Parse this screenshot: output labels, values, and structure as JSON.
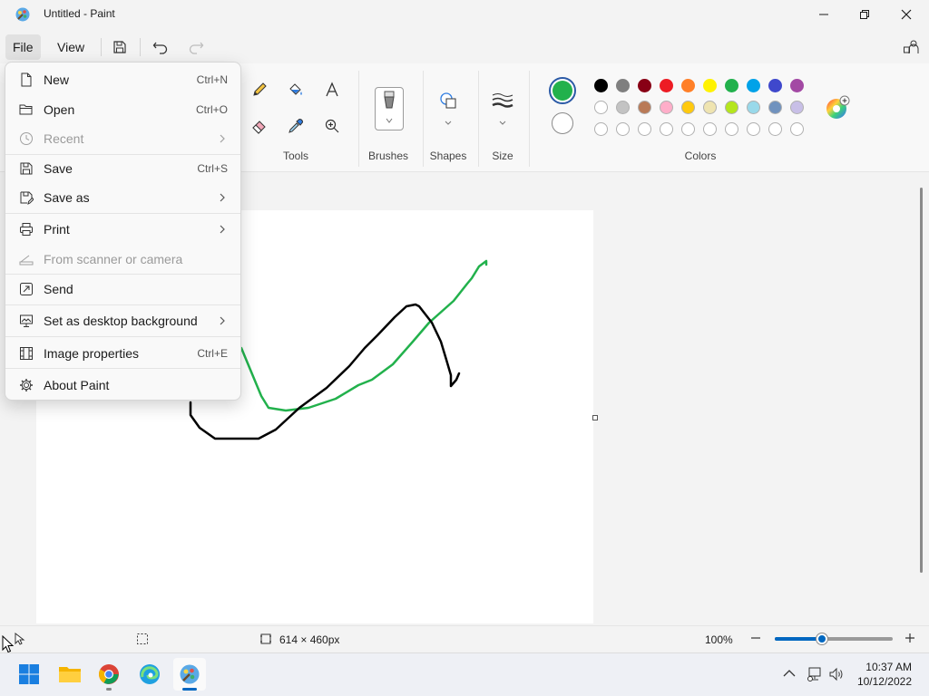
{
  "window": {
    "title": "Untitled - Paint"
  },
  "menubar": {
    "file_label": "File",
    "view_label": "View"
  },
  "ribbon": {
    "tools_label": "Tools",
    "brushes_label": "Brushes",
    "shapes_label": "Shapes",
    "size_label": "Size",
    "colors_label": "Colors",
    "primary_color": "#22b14c",
    "secondary_color": "#ffffff",
    "palette_row1": [
      "#000000",
      "#7f7f7f",
      "#880015",
      "#ed1c24",
      "#ff7f27",
      "#fff200",
      "#22b14c",
      "#00a2e8",
      "#3f48cc",
      "#a349a4"
    ],
    "palette_row2": [
      "#ffffff",
      "#c3c3c3",
      "#b97a57",
      "#ffaec9",
      "#ffc90e",
      "#efe4b0",
      "#b5e61d",
      "#99d9ea",
      "#7092be",
      "#c8bfe7"
    ],
    "palette_row3_count_empty": 10
  },
  "file_menu": {
    "items": [
      {
        "label": "New",
        "shortcut": "Ctrl+N"
      },
      {
        "label": "Open",
        "shortcut": "Ctrl+O"
      },
      {
        "label": "Recent",
        "disabled": true
      },
      {
        "label": "Save",
        "shortcut": "Ctrl+S"
      },
      {
        "label": "Save as"
      },
      {
        "label": "Print"
      },
      {
        "label": "From scanner or camera",
        "disabled": true
      },
      {
        "label": "Send"
      },
      {
        "label": "Set as desktop background"
      },
      {
        "label": "Image properties",
        "shortcut": "Ctrl+E"
      },
      {
        "label": "About Paint"
      }
    ]
  },
  "statusbar": {
    "canvas_size": "614 × 460px",
    "zoom": "100%",
    "zoom_level_fraction": 0.4
  },
  "taskbar": {
    "time": "10:37 AM",
    "date": "10/12/2022"
  }
}
